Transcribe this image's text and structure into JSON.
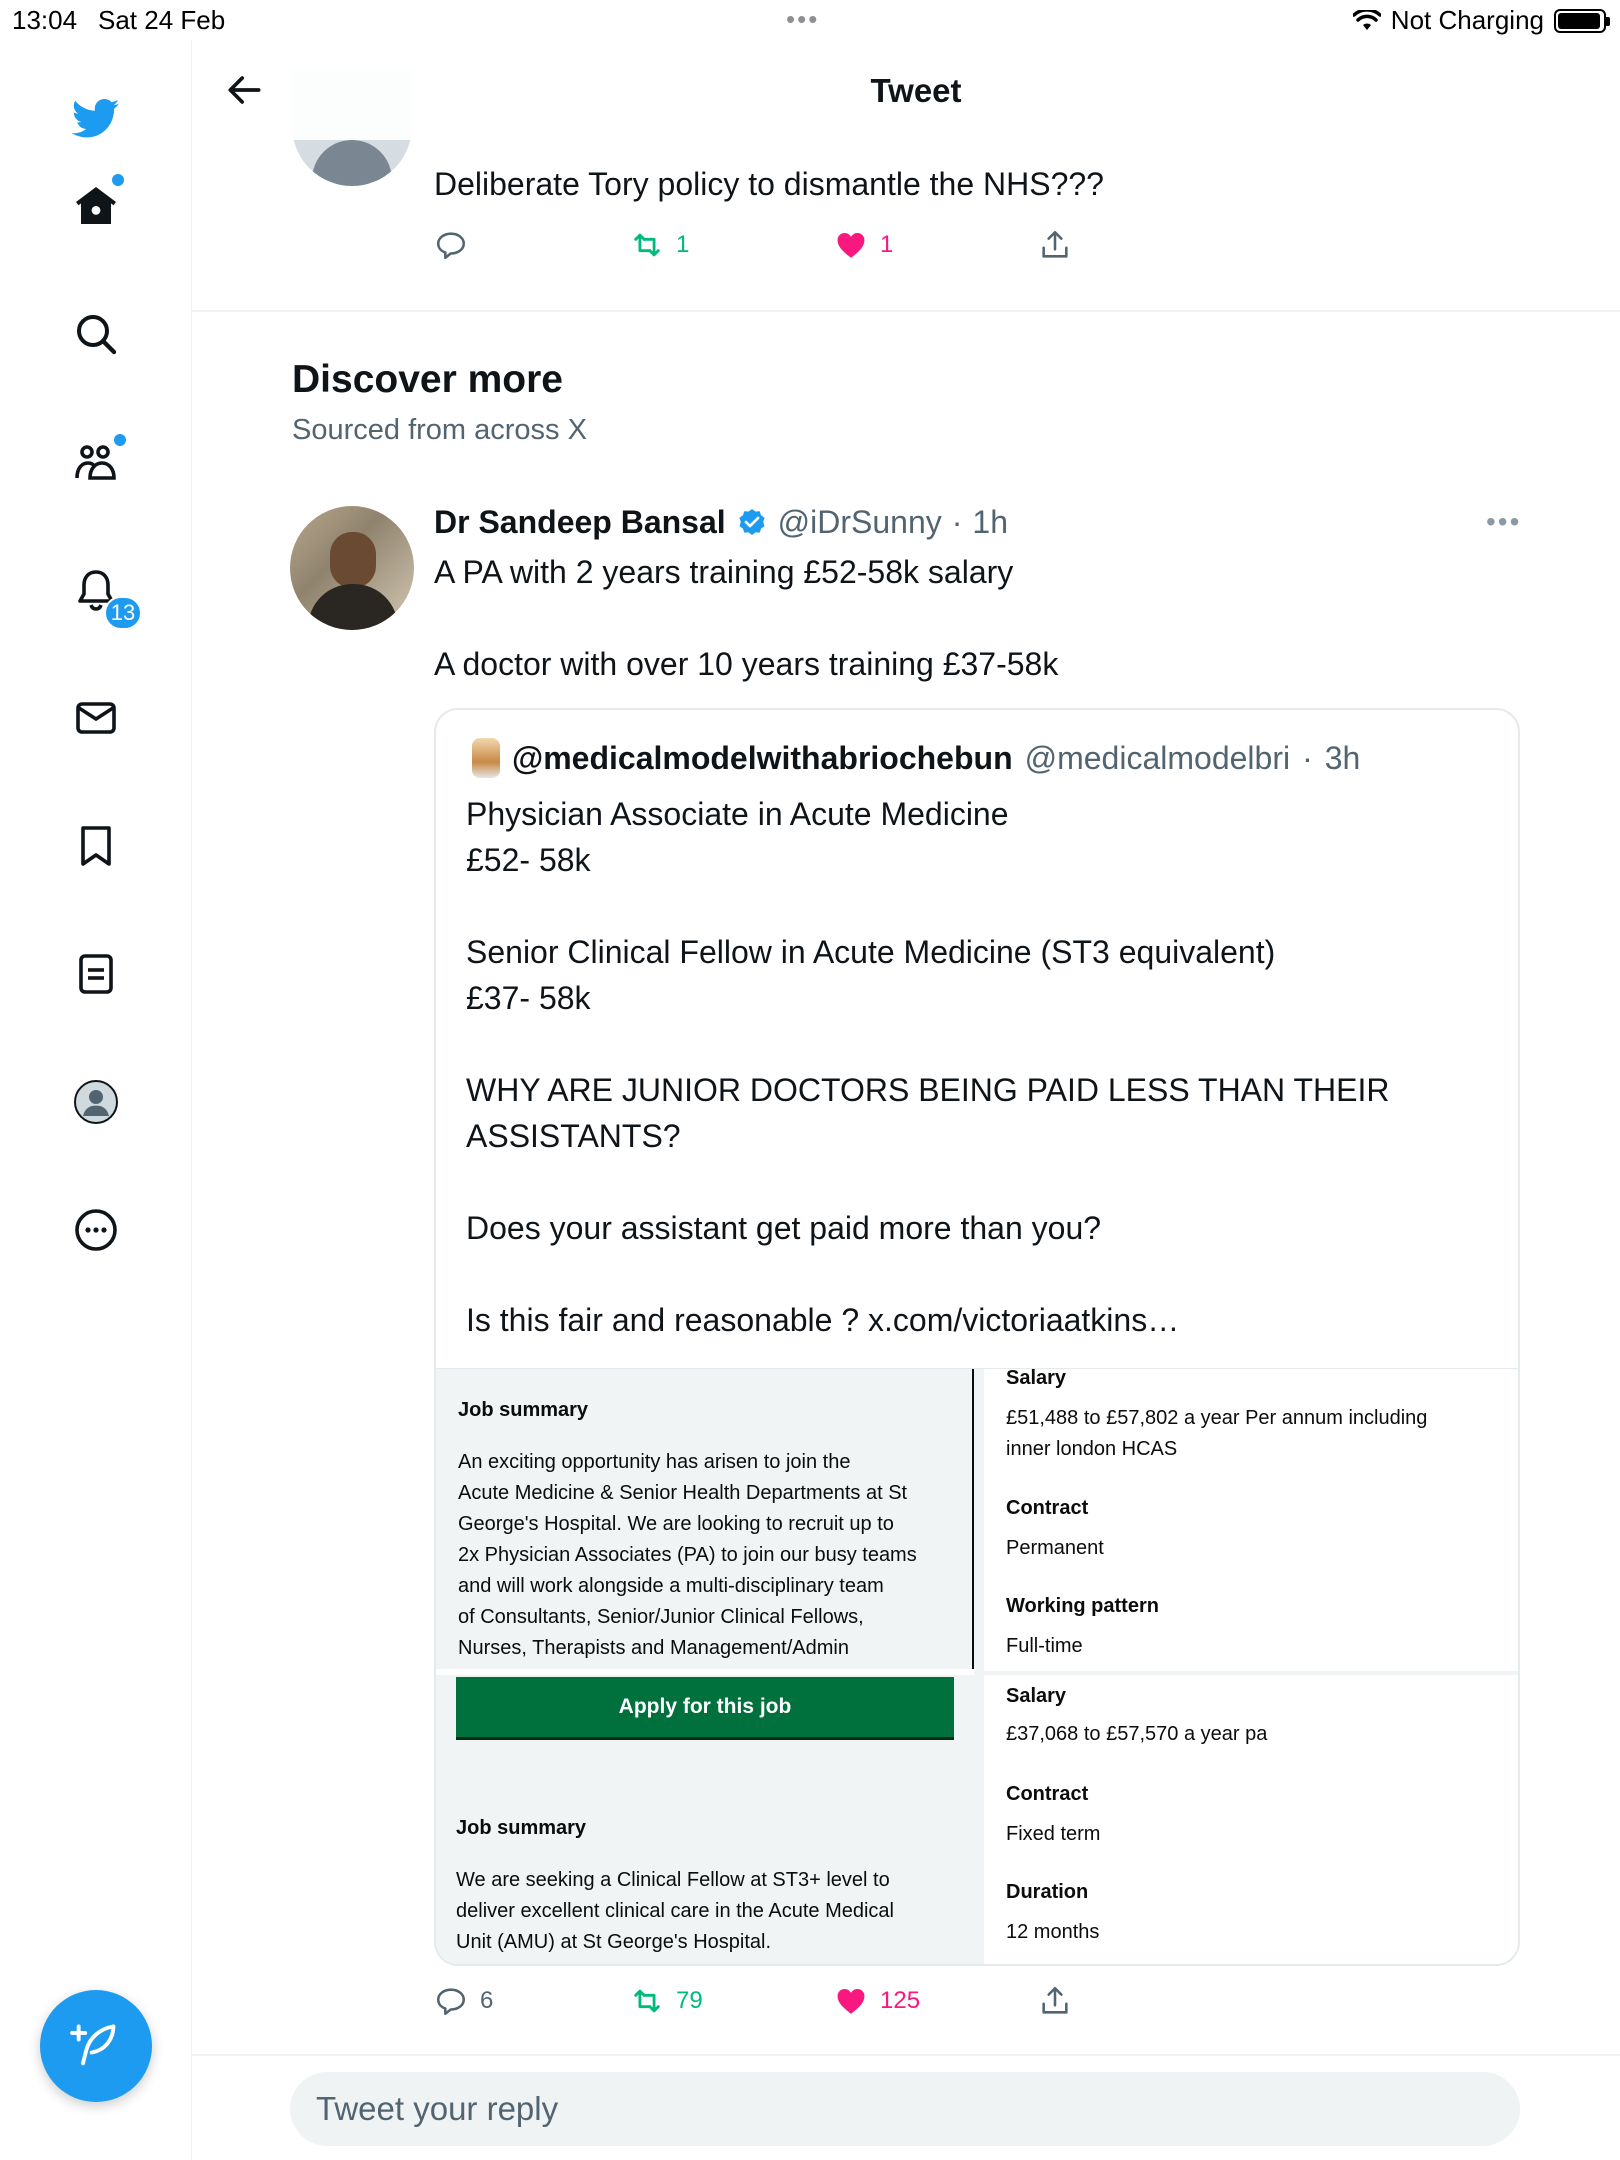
{
  "status_bar": {
    "time": "13:04",
    "date": "Sat 24 Feb",
    "charging": "Not Charging",
    "battery_level": 0.95
  },
  "sidebar": {
    "items": [
      {
        "name": "home",
        "icon": "home-icon",
        "has_dot": true
      },
      {
        "name": "search",
        "icon": "search-icon"
      },
      {
        "name": "communities",
        "icon": "communities-icon",
        "has_dot": true
      },
      {
        "name": "notifications",
        "icon": "bell-icon",
        "badge": "13"
      },
      {
        "name": "messages",
        "icon": "mail-icon"
      },
      {
        "name": "bookmarks",
        "icon": "bookmark-icon"
      },
      {
        "name": "lists",
        "icon": "lists-icon"
      },
      {
        "name": "profile",
        "icon": "profile-icon"
      },
      {
        "name": "more",
        "icon": "more-circle-icon"
      }
    ],
    "notification_badge": "13",
    "compose_icon": "compose-icon"
  },
  "header": {
    "title": "Tweet",
    "back_icon": "back-arrow-icon"
  },
  "previous_tweet": {
    "text": "Deliberate Tory policy to dismantle the NHS???",
    "retweets": "1",
    "likes": "1"
  },
  "discover": {
    "title": "Discover more",
    "subtitle": "Sourced from across X"
  },
  "main_tweet": {
    "author": "Dr Sandeep Bansal",
    "verified": true,
    "handle": "@iDrSunny",
    "separator": "·",
    "time_ago": "1h",
    "line1": "A PA with 2 years training £52-58k salary",
    "line2": "A doctor with over 10 years training £37-58k",
    "replies": "6",
    "retweets": "79",
    "likes": "125"
  },
  "quote": {
    "author": "@medicalmodelwithabriochebun",
    "handle": "@medicalmodelbri",
    "separator": "·",
    "time_ago": "3h",
    "lines": [
      "Physician Associate in Acute Medicine",
      "£52- 58k",
      "Senior Clinical Fellow in Acute Medicine (ST3 equivalent)",
      "£37- 58k",
      "WHY ARE JUNIOR DOCTORS BEING PAID LESS THAN THEIR",
      "ASSISTANTS?",
      "Does your assistant get paid more than you?",
      "Is this fair and reasonable ? x.com/victoriaatkins…"
    ]
  },
  "job_image": {
    "pa": {
      "summary_label": "Job summary",
      "summary_lines": [
        "An exciting opportunity has arisen to join the",
        "Acute Medicine & Senior Health Departments at St",
        "George's Hospital. We are looking to recruit up to",
        "2x Physician Associates (PA) to join our busy teams",
        "and will work alongside a multi-disciplinary team",
        "of Consultants, Senior/Junior Clinical Fellows,",
        "Nurses, Therapists and Management/Admin"
      ],
      "salary_label": "Salary",
      "salary_lines": [
        "£51,488 to £57,802 a year Per annum including",
        "inner london HCAS"
      ],
      "contract_label": "Contract",
      "contract_value": "Permanent",
      "pattern_label": "Working pattern",
      "pattern_value": "Full-time"
    },
    "fellow": {
      "apply_label": "Apply for this job",
      "summary_label": "Job summary",
      "summary_lines": [
        "We are seeking a Clinical Fellow at ST3+ level to",
        "deliver excellent clinical care in the Acute Medical",
        "Unit (AMU) at St George's Hospital."
      ],
      "salary_label": "Salary",
      "salary_value": "£37,068 to £57,570 a year pa",
      "contract_label": "Contract",
      "contract_value": "Fixed term",
      "duration_label": "Duration",
      "duration_value": "12 months"
    }
  },
  "reply": {
    "placeholder": "Tweet your reply"
  },
  "colors": {
    "brand": "#1d9bf0",
    "retweet": "#00ba7c",
    "like": "#f91880",
    "secondary_text": "#536471",
    "apply_button": "#00703c"
  }
}
